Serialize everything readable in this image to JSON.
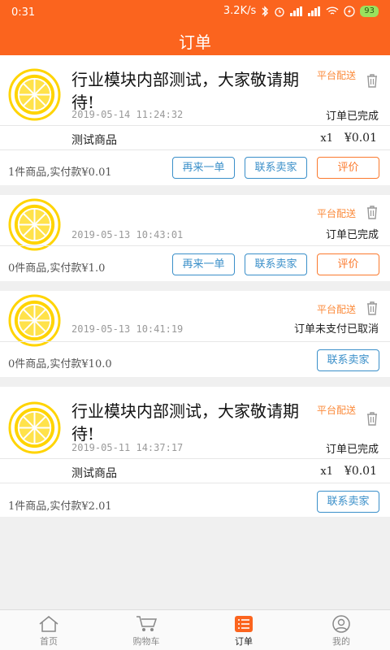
{
  "statusbar": {
    "time": "0:31",
    "speed": "3.2K/s",
    "battery": "93"
  },
  "header": {
    "title": "订单"
  },
  "orders": [
    {
      "title": "行业模块内部测试，大家敬请期待!",
      "date": "2019-05-14 11:24:32",
      "tag": "平台配送",
      "status": "订单已完成",
      "product": {
        "name": "测试商品",
        "qty": "x1",
        "price": "¥0.01"
      },
      "summary": "1件商品,实付款¥0.01",
      "buttons": [
        "再来一单",
        "联系卖家",
        "评价"
      ]
    },
    {
      "title": "",
      "date": "2019-05-13 10:43:01",
      "tag": "平台配送",
      "status": "订单已完成",
      "summary": "0件商品,实付款¥1.0",
      "buttons": [
        "再来一单",
        "联系卖家",
        "评价"
      ]
    },
    {
      "title": "",
      "date": "2019-05-13 10:41:19",
      "tag": "平台配送",
      "status": "订单未支付已取消",
      "summary": "0件商品,实付款¥10.0",
      "buttons": [
        "联系卖家"
      ]
    },
    {
      "title": "行业模块内部测试，大家敬请期待!",
      "date": "2019-05-11 14:37:17",
      "tag": "平台配送",
      "status": "订单已完成",
      "product": {
        "name": "测试商品",
        "qty": "x1",
        "price": "¥0.01"
      },
      "summary": "1件商品,实付款¥2.01",
      "buttons": [
        "联系卖家"
      ]
    }
  ],
  "tabbar": {
    "items": [
      {
        "label": "首页",
        "icon": "home-icon"
      },
      {
        "label": "购物车",
        "icon": "cart-icon"
      },
      {
        "label": "订单",
        "icon": "orders-icon"
      },
      {
        "label": "我的",
        "icon": "profile-icon"
      }
    ],
    "active": "订单"
  },
  "colors": {
    "accent": "#fb641e",
    "blue": "#3a8fc9",
    "orange": "#fb7a2e"
  }
}
